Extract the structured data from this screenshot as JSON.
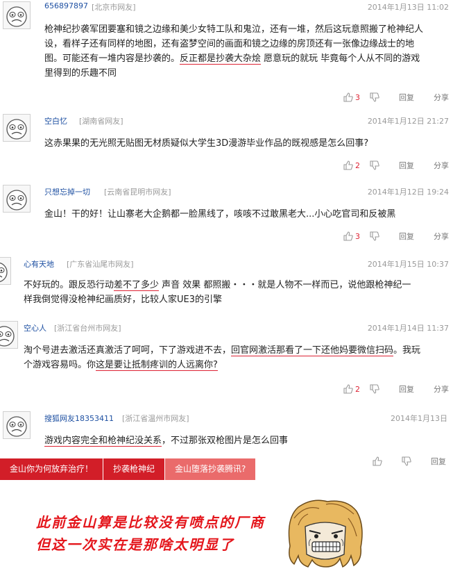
{
  "comments": [
    {
      "user": "656897897",
      "location": "[北京市网友]",
      "time": "2014年1月13日  11:02",
      "lines": [
        "枪神纪抄袭军团要塞和镜之边缘和美少女特工队和鬼泣，还有一堆，然后这玩意照搬了枪神纪人",
        "设，看样子还有同样的地图，还有盗梦空间的画面和镜之边缘的房顶还有一张像边缘战士的地"
      ],
      "line3_pre": "图。可能还有一堆内容是抄袭的。",
      "line3_ul": "反正都是抄袭大杂烩",
      "line3_post": " 愿意玩的就玩 毕竟每个人从不同的游戏",
      "line4": "里得到的乐趣不同",
      "likes": "3",
      "reply": "回复",
      "share": "分享"
    },
    {
      "user": "空白忆",
      "location": "[湖南省网友]",
      "time": "2014年1月12日  21:27",
      "text": "这赤果果的无光照无贴图无材质疑似大学生3D漫游毕业作品的既视感是怎么回事?",
      "likes": "2",
      "reply": "回复",
      "share": "分享"
    },
    {
      "user": "只想忘掉一切",
      "location": "[云南省昆明市网友]",
      "time": "2014年1月12日  19:24",
      "text": "金山！干的好！让山寨老大企鹅都一脸黑线了，咳咳不过敢黑老大...小心吃官司和反被黑",
      "likes": "3",
      "reply": "回复",
      "share": "分享"
    },
    {
      "user": "心有天地",
      "location": "[广东省汕尾市网友]",
      "time": "2014年1月15日  10:37",
      "l1_pre": "不好玩的。跟反恐行动",
      "l1_ul": "差不了多少",
      "l1_post": " 声音 效果 都照搬・・・就是人物不一样而已，说他跟枪神纪一",
      "l2": "样我倒觉得没枪神纪画质好，比较人家UE3的引擎"
    },
    {
      "user": "空心人",
      "location": "[浙江省台州市网友]",
      "time": "2014年1月14日  11:37",
      "l1_pre": "淘个号进去激活还真激活了呵呵，下了游戏进不去，",
      "l1_ul": "回官网激活那看了一下还他妈要微信扫码",
      "l1_post": "。我玩",
      "l2_pre": "个游戏容易吗。你",
      "l2_ul": "这是要让抵制疼训的人远离你?",
      "likes": "2",
      "reply": "回复",
      "share": "分享"
    },
    {
      "user": "搜狐网友18353411",
      "location": "[浙江省温州市网友]",
      "time": "2014年1月13日",
      "l1_ul": "游戏内容完全和枪神纪没关系",
      "l1_post": "，不过那张双枪图片是怎么回事",
      "reply": "回复"
    }
  ],
  "tabs": [
    "金山你为何放弃治疗！",
    "抄袭枪神纪",
    "金山堕落抄袭腾讯?"
  ],
  "caption": {
    "line1": "此前金山算是比较没有喷点的厂商",
    "line2": "但这一次实在是那啥太明显了"
  },
  "colors": {
    "accent_red": "#d21e28",
    "tab_light": "#ea6b6b",
    "user_blue": "#1e50a2",
    "caption_red": "#e4161c"
  },
  "icons": [
    "smiley-avatar-icon",
    "thumbs-up-icon",
    "thumbs-down-icon",
    "rage-face-icon"
  ]
}
